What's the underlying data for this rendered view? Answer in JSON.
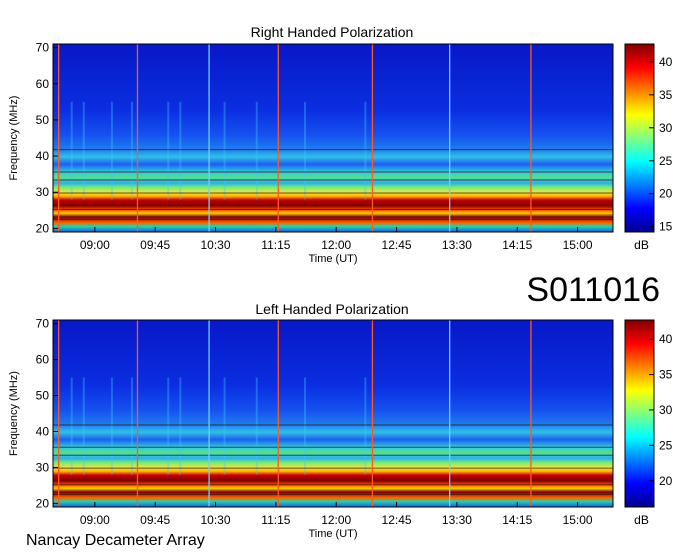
{
  "colors": {
    "accent": "#ffffff"
  },
  "title_id": "S011016",
  "footer": "Nancay Decameter Array",
  "colorscale": [
    "#00008f",
    "#0000ff",
    "#0080ff",
    "#00ffff",
    "#80ff80",
    "#ffff00",
    "#ff8000",
    "#ff0000",
    "#800000"
  ],
  "chart_data": [
    {
      "type": "heatmap",
      "title": "Right Handed Polarization",
      "xlabel": "Time (UT)",
      "ylabel": "Frequency (MHz)",
      "x_ticks": [
        "09:00",
        "09:45",
        "10:30",
        "11:15",
        "12:00",
        "12:45",
        "13:30",
        "14:15",
        "15:00"
      ],
      "x_tick_hours": [
        9.0,
        9.75,
        10.5,
        11.25,
        12.0,
        12.75,
        13.5,
        14.25,
        15.0
      ],
      "xlim_hours": [
        8.48,
        15.44
      ],
      "y_ticks": [
        20,
        30,
        40,
        50,
        60,
        70
      ],
      "ylim": [
        19,
        71
      ],
      "colorbar": {
        "label": "dB",
        "ticks": [
          15,
          20,
          25,
          30,
          35,
          40
        ],
        "range": [
          14.2,
          42.7
        ]
      }
    },
    {
      "type": "heatmap",
      "title": "Left Handed Polarization",
      "xlabel": "Time (UT)",
      "ylabel": "Frequency (MHz)",
      "x_ticks": [
        "09:00",
        "09:45",
        "10:30",
        "11:15",
        "12:00",
        "12:45",
        "13:30",
        "14:15",
        "15:00"
      ],
      "x_tick_hours": [
        9.0,
        9.75,
        10.5,
        11.25,
        12.0,
        12.75,
        13.5,
        14.25,
        15.0
      ],
      "xlim_hours": [
        8.48,
        15.44
      ],
      "y_ticks": [
        20,
        30,
        40,
        50,
        60,
        70
      ],
      "ylim": [
        19,
        71
      ],
      "colorbar": {
        "label": "dB",
        "ticks": [
          20,
          25,
          30,
          35,
          40
        ],
        "range": [
          16.3,
          42.7
        ]
      }
    }
  ]
}
